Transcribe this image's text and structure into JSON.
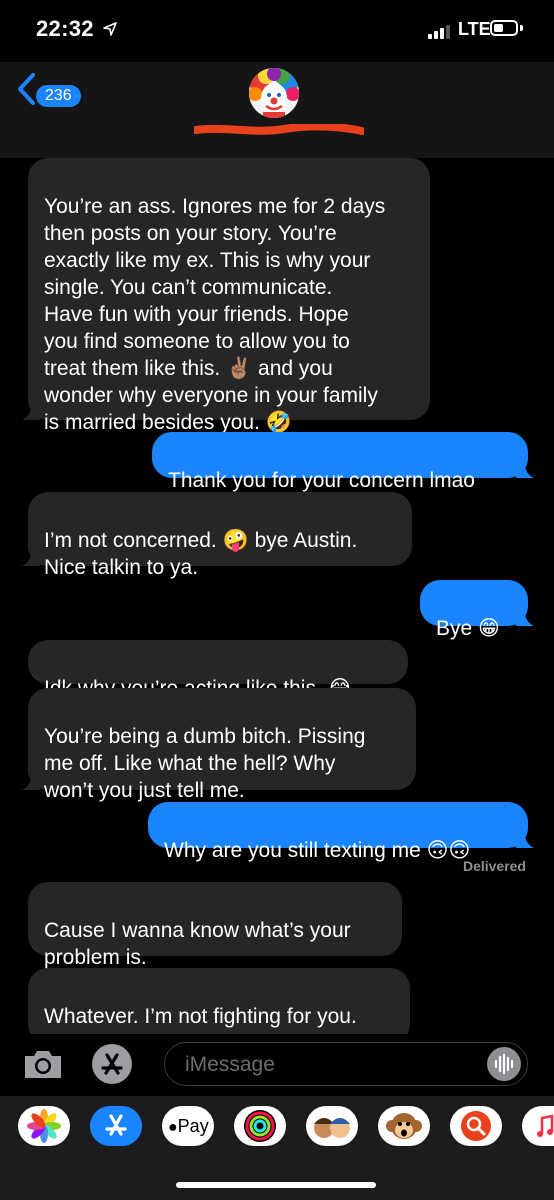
{
  "status_bar": {
    "time": "22:32",
    "network": "LTE"
  },
  "header": {
    "back_count": "236"
  },
  "messages": [
    {
      "dir": "recv",
      "text": "You’re an ass. Ignores me for 2 days\nthen posts on your story. You’re\nexactly like my ex. This is why your\nsingle. You can’t communicate.\nHave fun with your friends. Hope\nyou find someone to allow you to\ntreat them like this. ✌🏽 and you\nwonder why everyone in your family\nis married besides you. 🤣"
    },
    {
      "dir": "sent",
      "text": "Thank you for your concern lmao"
    },
    {
      "dir": "recv",
      "text": "I’m not concerned. 🤪 bye Austin.\nNice talkin to ya."
    },
    {
      "dir": "sent",
      "text": "Bye 😁"
    },
    {
      "dir": "recv",
      "text": "Idk why you’re acting like this. 😂"
    },
    {
      "dir": "recv",
      "text": "You’re being a dumb bitch. Pissing\nme off. Like what the hell? Why\nwon’t you just tell me."
    },
    {
      "dir": "sent",
      "text": "Why are you still texting me 🙃🙃"
    },
    {
      "dir": "recv",
      "text": " Cause I wanna know what’s your\nproblem is."
    },
    {
      "dir": "recv",
      "text": "Whatever. I’m not fighting for you.\nYou wouldn’t do the same for me."
    }
  ],
  "delivered_label": "Delivered",
  "input": {
    "placeholder": "iMessage"
  },
  "app_drawer": {
    "apple_pay_label": "Pay",
    "apps": [
      "photos-icon",
      "app-store-icon",
      "apple-pay-icon",
      "activity-icon",
      "memoji-icon",
      "animoji-icon",
      "web-images-icon",
      "music-icon"
    ]
  },
  "colors": {
    "sent": "#1b84ff",
    "received": "#262628",
    "background": "#000000"
  }
}
